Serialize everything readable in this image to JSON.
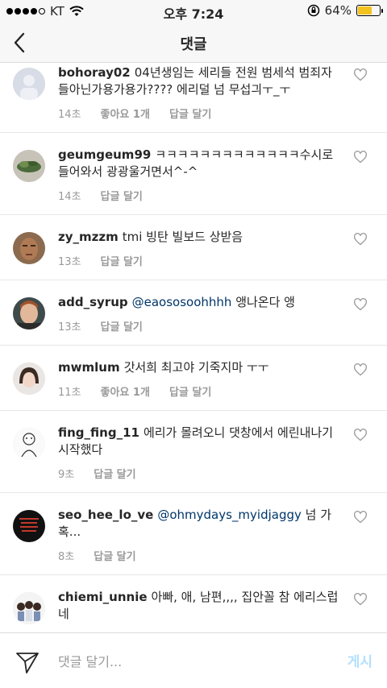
{
  "status_bar": {
    "carrier": "KT",
    "time": "오후 7:24",
    "battery_text": "64%",
    "battery_level": 0.64,
    "battery_color": "#f3c21f"
  },
  "header": {
    "title": "댓글"
  },
  "labels": {
    "like": "좋아요 1개",
    "reply": "답글 달기"
  },
  "comments": [
    {
      "username": "bohoray02",
      "prefix": "",
      "text": "04년생임는 세리들 전원 범세석 범죄자들아닌가용가용가???? 에리덜 넘 무섭긔ㅜ_ㅜ",
      "time": "14초",
      "likes": "좋아요 1개",
      "reply": "답글 달기"
    },
    {
      "username": "geumgeum99",
      "prefix": "",
      "text": "ㅋㅋㅋㅋㅋㅋㅋㅋㅋㅋㅋㅋㅋ수시로 들어와서 광광울거면서^-^",
      "time": "14초",
      "likes": "",
      "reply": "답글 달기"
    },
    {
      "username": "zy_mzzm",
      "prefix": "",
      "text": "tmi 빙탄 빌보드 상받음",
      "time": "13초",
      "likes": "",
      "reply": "답글 달기"
    },
    {
      "username": "add_syrup",
      "prefix": "@eaososoohhhh",
      "text": "앵나온다 앵",
      "time": "13초",
      "likes": "",
      "reply": "답글 달기"
    },
    {
      "username": "mwmlum",
      "prefix": "",
      "text": "갓서희 최고야 기죽지마 ㅜㅜ",
      "time": "11초",
      "likes": "좋아요 1개",
      "reply": "답글 달기"
    },
    {
      "username": "fing_fing_11",
      "prefix": "",
      "text": "에리가 몰려오니 댓창에서 에린내나기 시작했다",
      "time": "9초",
      "likes": "",
      "reply": "답글 달기"
    },
    {
      "username": "seo_hee_lo_ve",
      "prefix": "@ohmydays_myidjaggy",
      "text": "넘 가혹...",
      "time": "8초",
      "likes": "",
      "reply": "답글 달기"
    },
    {
      "username": "chiemi_unnie",
      "prefix": "",
      "text": "아빠, 애, 남편,,,, 집안꼴 참 에리스럽네",
      "time": "8초",
      "likes": "",
      "reply": "답글 달기"
    }
  ],
  "composer": {
    "placeholder": "댓글 달기...",
    "post_label": "게시"
  }
}
